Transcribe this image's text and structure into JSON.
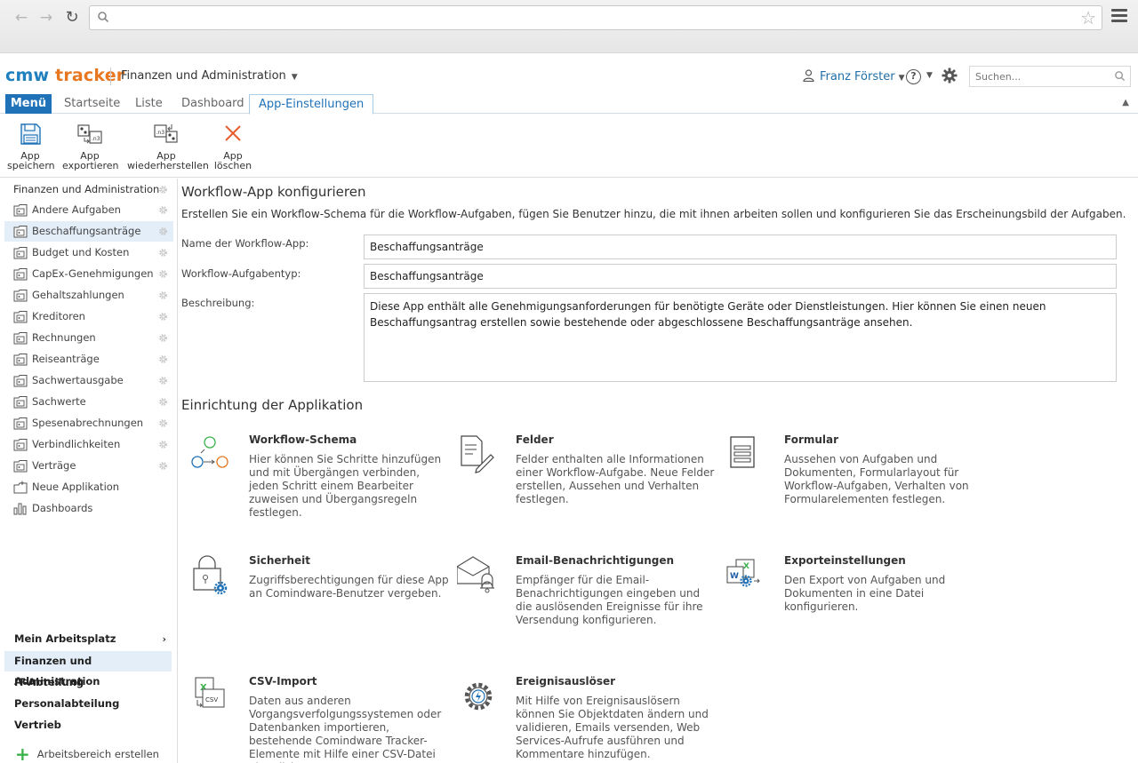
{
  "browser": {
    "url": ""
  },
  "header": {
    "logo_part1": "cmw",
    "logo_part2": "tracker",
    "workspace": "Finanzen und Administration",
    "user": "Franz Förster",
    "help": "?",
    "search_placeholder": "Suchen..."
  },
  "tabs": [
    {
      "label": "Menü"
    },
    {
      "label": "Startseite"
    },
    {
      "label": "Liste"
    },
    {
      "label": "Dashboard"
    },
    {
      "label": "App-Einstellungen"
    }
  ],
  "toolbar": [
    {
      "line1": "App",
      "line2": "speichern"
    },
    {
      "line1": "App",
      "line2": "exportieren"
    },
    {
      "line1": "App",
      "line2": "wiederherstellen"
    },
    {
      "line1": "App",
      "line2": "löschen"
    }
  ],
  "sidebar": {
    "root": "Finanzen und Administration",
    "items": [
      {
        "label": "Andere Aufgaben"
      },
      {
        "label": "Beschaffungsanträge"
      },
      {
        "label": "Budget und Kosten"
      },
      {
        "label": "CapEx-Genehmigungen"
      },
      {
        "label": "Gehaltszahlungen"
      },
      {
        "label": "Kreditoren"
      },
      {
        "label": "Rechnungen"
      },
      {
        "label": "Reiseanträge"
      },
      {
        "label": "Sachwertausgabe"
      },
      {
        "label": "Sachwerte"
      },
      {
        "label": "Spesenabrechnungen"
      },
      {
        "label": "Verbindlichkeiten"
      },
      {
        "label": "Verträge"
      },
      {
        "label": "Neue Applikation"
      },
      {
        "label": "Dashboards"
      }
    ],
    "workspaces": [
      {
        "label": "Mein Arbeitsplatz"
      },
      {
        "label": "Finanzen und Administration"
      },
      {
        "label": "IT-Abteilung"
      },
      {
        "label": "Personalabteilung"
      },
      {
        "label": "Vertrieb"
      }
    ],
    "add_workspace": "Arbeitsbereich erstellen"
  },
  "main": {
    "title": "Workflow-App konfigurieren",
    "intro": "Erstellen Sie ein Workflow-Schema für die Workflow-Aufgaben, fügen Sie Benutzer hinzu, die mit ihnen arbeiten sollen und konfigurieren Sie das Erscheinungsbild der Aufgaben.",
    "fields": {
      "name_label": "Name der Workflow-App:",
      "name_value": "Beschaffungsanträge",
      "type_label": "Workflow-Aufgabentyp:",
      "type_value": "Beschaffungsanträge",
      "desc_label": "Beschreibung:",
      "desc_value": "Diese App enthält alle Genehmigungsanforderungen für benötigte Geräte oder Dienstleistungen. Hier können Sie einen neuen Beschaffungsantrag erstellen sowie bestehende oder abgeschlossene Beschaffungsanträge ansehen."
    },
    "setup_title": "Einrichtung der Applikation",
    "cards": [
      {
        "title": "Workflow-Schema",
        "desc": "Hier können Sie Schritte hinzufügen und mit Übergängen verbinden, jeden Schritt einem Bearbeiter zuweisen und Übergangsregeln festlegen."
      },
      {
        "title": "Felder",
        "desc": "Felder enthalten alle Informationen einer Workflow-Aufgabe. Neue Felder erstellen, Aussehen und Verhalten festlegen."
      },
      {
        "title": "Formular",
        "desc": "Aussehen von Aufgaben und Dokumenten, Formularlayout für Workflow-Aufgaben, Verhalten von Formularelementen festlegen."
      },
      {
        "title": "Sicherheit",
        "desc": "Zugriffsberechtigungen für diese App an Comindware-Benutzer vergeben."
      },
      {
        "title": "Email-Benachrichtigungen",
        "desc": "Empfänger für die Email-Benachrichtigungen eingeben und die auslösenden Ereignisse für ihre Versendung konfigurieren."
      },
      {
        "title": "Exporteinstellungen",
        "desc": "Den Export von Aufgaben und Dokumenten in eine Datei konfigurieren."
      },
      {
        "title": "CSV-Import",
        "desc": "Daten aus anderen Vorgangsverfolgungssystemen oder Datenbanken importieren, bestehende Comindware Tracker-Elemente mit Hilfe einer CSV-Datei aktualisieren."
      },
      {
        "title": "Ereignisauslöser",
        "desc": "Mit Hilfe von Ereignisauslösern können Sie Objektdaten ändern und validieren, Emails versenden, Web Services-Aufrufe ausführen und Kommentare hinzufügen."
      }
    ]
  }
}
